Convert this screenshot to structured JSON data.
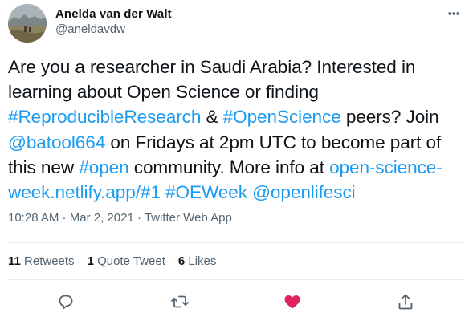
{
  "author": {
    "display_name": "Anelda van der Walt",
    "handle": "@aneldavdw"
  },
  "tweet": {
    "lines": [
      [
        {
          "text": "Are you a researcher in Saudi Arabia? Interested in",
          "link": false
        }
      ],
      [
        {
          "text": "learning about Open Science or finding",
          "link": false
        }
      ],
      [
        {
          "text": "#ReproducibleResearch",
          "link": true
        },
        {
          "text": " & ",
          "link": false
        },
        {
          "text": "#OpenScience",
          "link": true
        },
        {
          "text": " peers? Join",
          "link": false
        }
      ],
      [
        {
          "text": "@batool664",
          "link": true
        },
        {
          "text": " on Fridays at 2pm UTC to become part of",
          "link": false
        }
      ],
      [
        {
          "text": "this new ",
          "link": false
        },
        {
          "text": "#open",
          "link": true
        },
        {
          "text": " community. More info at ",
          "link": false
        },
        {
          "text": "open-science-",
          "link": true
        }
      ],
      [
        {
          "text": "week.netlify.app/#1",
          "link": true
        },
        {
          "text": " ",
          "link": false
        },
        {
          "text": "#OEWeek",
          "link": true
        },
        {
          "text": " ",
          "link": false
        },
        {
          "text": "@openlifesci",
          "link": true
        }
      ]
    ]
  },
  "meta": {
    "time": "10:28 AM",
    "separator": " · ",
    "date": "Mar 2, 2021",
    "source": "Twitter Web App"
  },
  "stats": {
    "retweets_count": "11",
    "retweets_label": "Retweets",
    "quotes_count": "1",
    "quotes_label": "Quote Tweet",
    "likes_count": "6",
    "likes_label": "Likes"
  },
  "colors": {
    "link": "#1d9bf0",
    "like": "#e0245e",
    "secondary_text": "#536471"
  },
  "icons": {
    "more": "ellipsis-icon",
    "reply": "reply-icon",
    "retweet": "retweet-icon",
    "like": "heart-filled-icon",
    "share": "share-icon"
  }
}
